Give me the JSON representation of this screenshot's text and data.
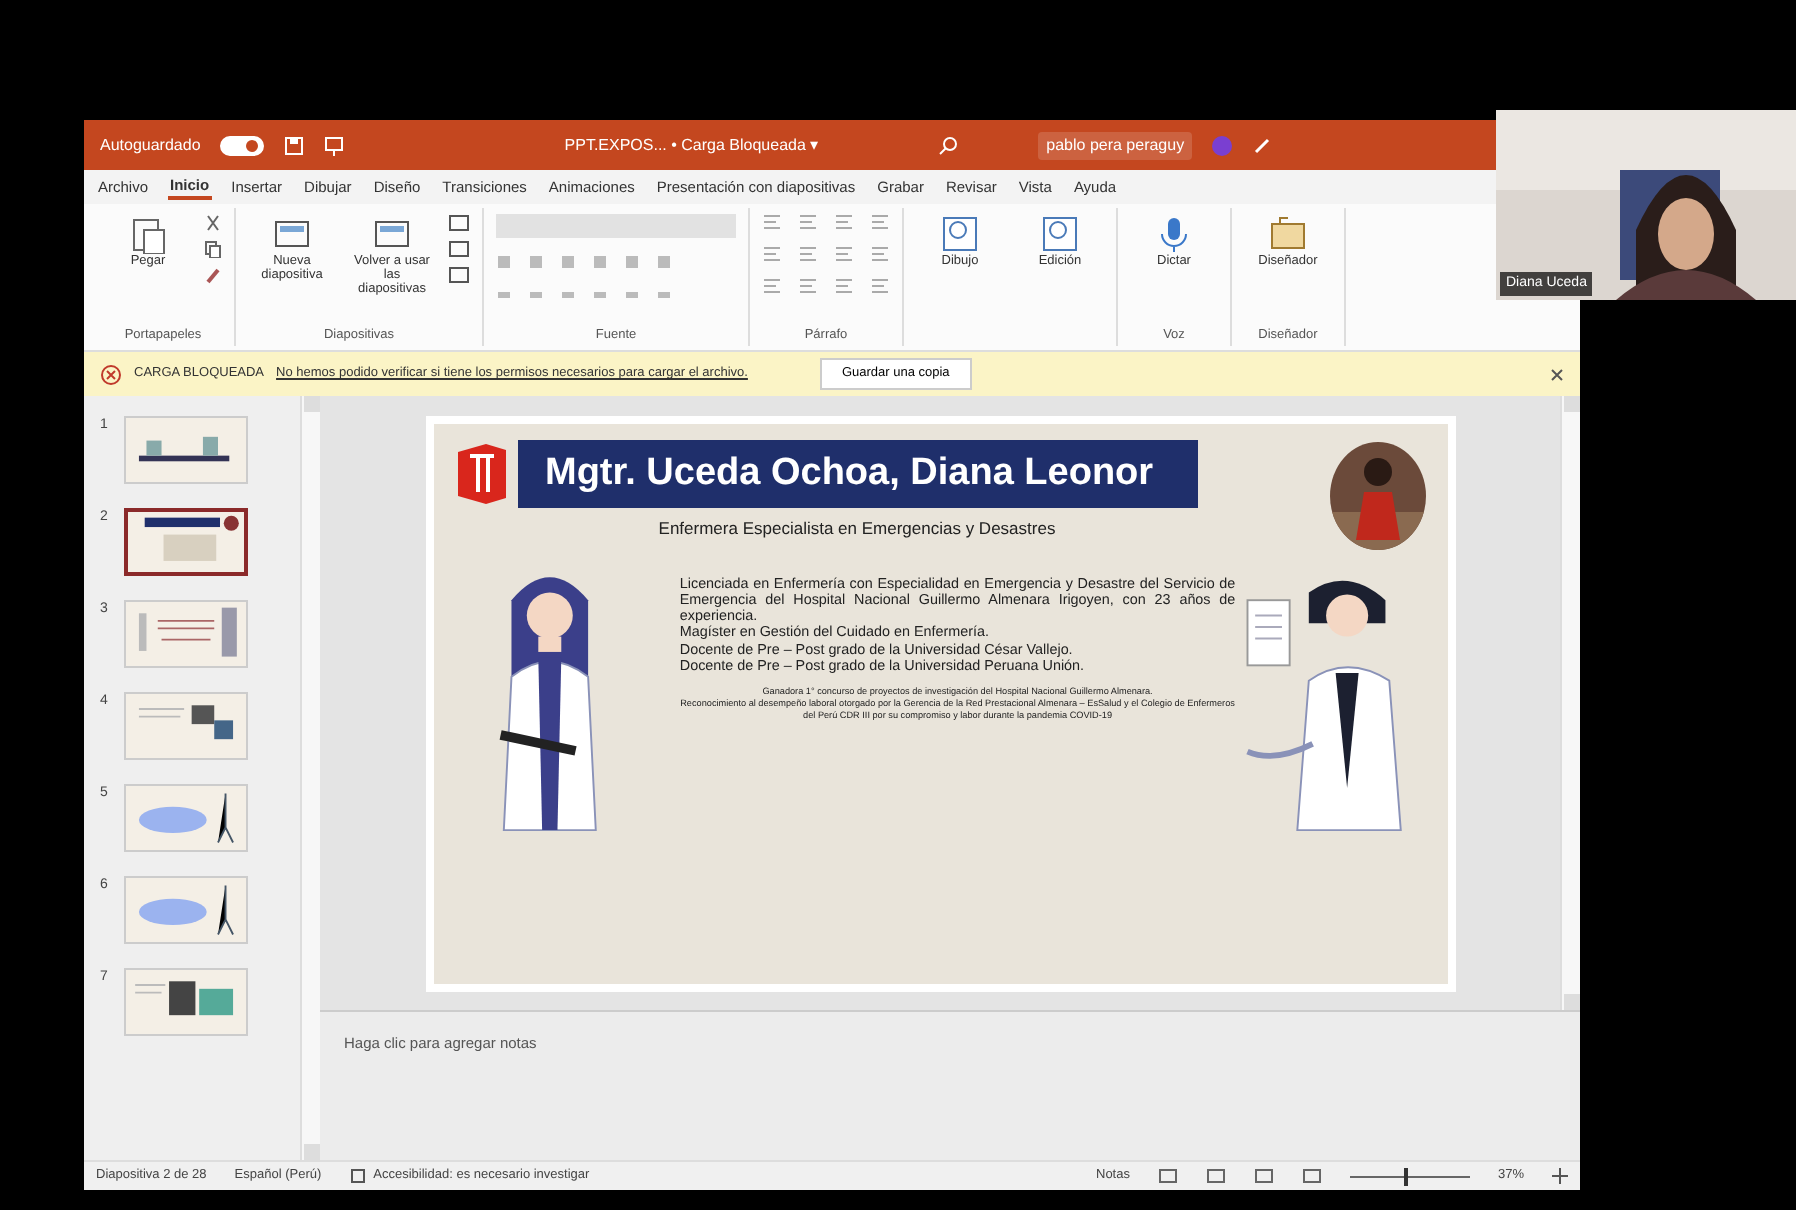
{
  "title_bar": {
    "autosave_label": "Autoguardado",
    "autosave_on": true,
    "file_title": "PPT.EXPOS... • Carga Bloqueada ▾",
    "user": "pablo pera peraguy"
  },
  "tabs": [
    {
      "label": "Archivo",
      "selected": false
    },
    {
      "label": "Inicio",
      "selected": true
    },
    {
      "label": "Insertar",
      "selected": false
    },
    {
      "label": "Dibujar",
      "selected": false
    },
    {
      "label": "Diseño",
      "selected": false
    },
    {
      "label": "Transiciones",
      "selected": false
    },
    {
      "label": "Animaciones",
      "selected": false
    },
    {
      "label": "Presentación con diapositivas",
      "selected": false
    },
    {
      "label": "Grabar",
      "selected": false
    },
    {
      "label": "Revisar",
      "selected": false
    },
    {
      "label": "Vista",
      "selected": false
    },
    {
      "label": "Ayuda",
      "selected": false
    }
  ],
  "ribbon": [
    {
      "kind": "clipboard",
      "label": "Portapapeles",
      "buttons": [
        "Pegar"
      ]
    },
    {
      "kind": "slides",
      "label": "Diapositivas",
      "buttons": [
        "Nueva diapositiva",
        "Volver a usar las diapositivas"
      ]
    },
    {
      "kind": "font",
      "label": "Fuente"
    },
    {
      "kind": "paragraph",
      "label": "Párrafo"
    },
    {
      "kind": "tools",
      "buttons": [
        "Dibujo",
        "Edición"
      ]
    },
    {
      "kind": "voice",
      "label": "Voz",
      "buttons": [
        "Dictar"
      ]
    },
    {
      "kind": "designer",
      "label": "Diseñador",
      "buttons": [
        "Diseñador"
      ]
    }
  ],
  "banner": {
    "title": "CARGA BLOQUEADA",
    "message": "No hemos podido verificar si tiene los permisos necesarios para cargar el archivo.",
    "button": "Guardar una copia"
  },
  "thumbnails": [
    {
      "number": "1",
      "selected": false
    },
    {
      "number": "2",
      "selected": true
    },
    {
      "number": "3",
      "selected": false
    },
    {
      "number": "4",
      "selected": false
    },
    {
      "number": "5",
      "selected": false
    },
    {
      "number": "6",
      "selected": false
    },
    {
      "number": "7",
      "selected": false
    }
  ],
  "slide": {
    "title": "Mgtr. Uceda Ochoa, Diana Leonor",
    "subtitle": "Enfermera Especialista en Emergencias y Desastres",
    "paragraphs": [
      "Licenciada en Enfermería con Especialidad en Emergencia y Desastre del Servicio de Emergencia del Hospital Nacional Guillermo Almenara Irigoyen, con 23 años de experiencia.",
      "Magíster en Gestión del Cuidado en Enfermería.",
      "Docente de Pre – Post grado de la Universidad César Vallejo.",
      "Docente de Pre – Post grado de la Universidad Peruana Unión."
    ],
    "notes": [
      "Ganadora 1° concurso de proyectos de investigación del Hospital Nacional Guillermo Almenara.",
      "Reconocimiento al desempeño laboral otorgado por la Gerencia de la Red Prestacional Almenara – EsSalud y el Colegio de Enfermeros del Perú CDR III por su compromiso y labor durante la pandemia COVID-19"
    ]
  },
  "notes_placeholder": "Haga clic para agregar notas",
  "status_bar": {
    "slide_position": "Diapositiva 2 de 28",
    "language": "Español (Perú)",
    "accessibility": "Accesibilidad: es necesario investigar",
    "notes": "Notas",
    "zoom": "37%",
    "level": 0.45
  },
  "video": {
    "name": "Diana Uceda"
  }
}
